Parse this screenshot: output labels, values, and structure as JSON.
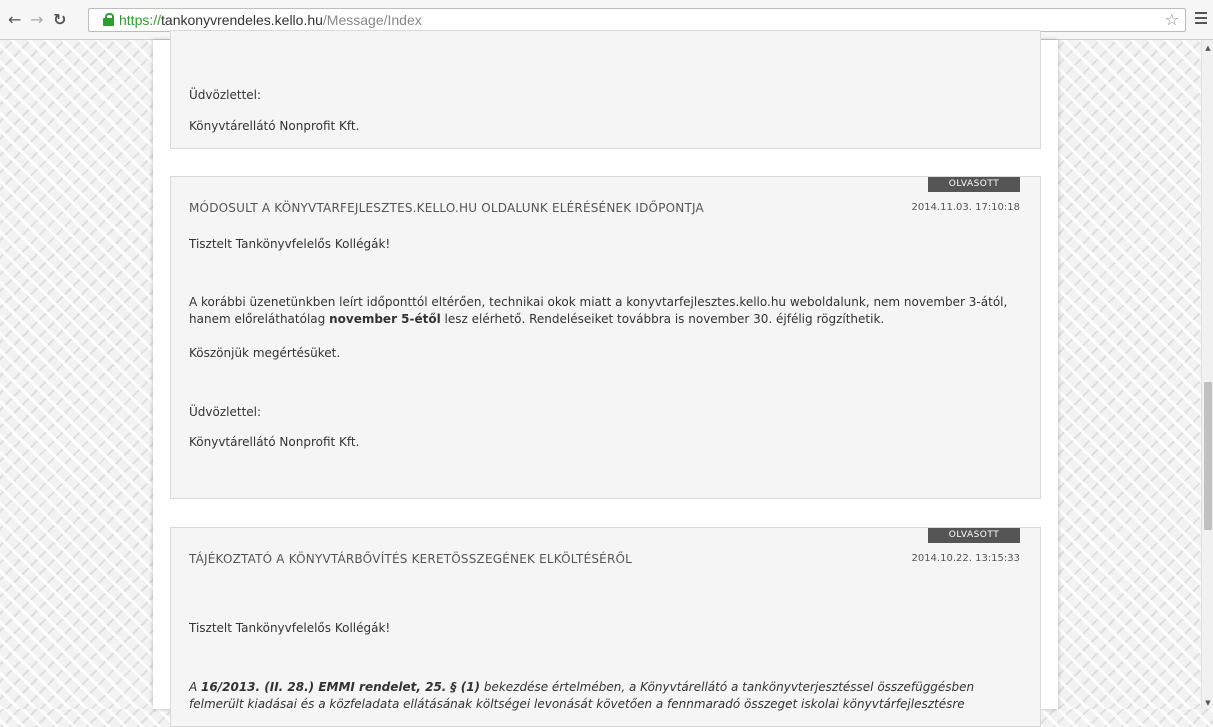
{
  "browser": {
    "url_scheme": "https://",
    "url_host": "tankonyvrendeles.kello.hu",
    "url_path": "/Message/Index"
  },
  "prev_message": {
    "greeting": "Üdvözlettel:",
    "signature": "Könyvtárellátó Nonprofit Kft."
  },
  "messages": [
    {
      "badge": "OLVASOTT",
      "title": "MÓDOSULT A KÖNYVTARFEJLESZTES.KELLO.HU OLDALUNK ELÉRÉSÉNEK IDŐPONTJA",
      "date": "2014.11.03. 17:10:18",
      "salutation": "Tisztelt Tankönyvfelelős Kollégák!",
      "body_line1": "A korábbi üzenetünkben leírt időponttól eltérően, technikai okok miatt a konyvtarfejlesztes.kello.hu weboldalunk, nem november 3-ától,",
      "body_line2_pre": "hanem előreláthatólag ",
      "body_line2_bold": "november 5-étől",
      "body_line2_post": " lesz elérhető. Rendeléseiket továbbra is november 30. éjfélig rögzíthetik.",
      "thanks": "Köszönjük megértésüket.",
      "greeting": "Üdvözlettel:",
      "signature": "Könyvtárellátó Nonprofit Kft."
    },
    {
      "badge": "OLVASOTT",
      "title": "TÁJÉKOZTATÓ A KÖNYVTÁRBŐVÍTÉS KERETÖSSZEGÉNEK ELKÖLTÉSÉRŐL",
      "date": "2014.10.22. 13:15:33",
      "salutation": "Tisztelt Tankönyvfelelős Kollégák!",
      "body_line1_pre": "A ",
      "body_line1_bold": "16/2013. (II. 28.) EMMI rendelet, 25. § (1)",
      "body_line1_post": " bekezdése értelmében, a Könyvtárellátó  a tankönyvterjesztéssel összefüggésben",
      "body_line2": "felmerült kiadásai és a közfeladata ellátásának költségei levonását követően a fennmaradó összeget iskolai könyvtárfejlesztésre"
    }
  ]
}
